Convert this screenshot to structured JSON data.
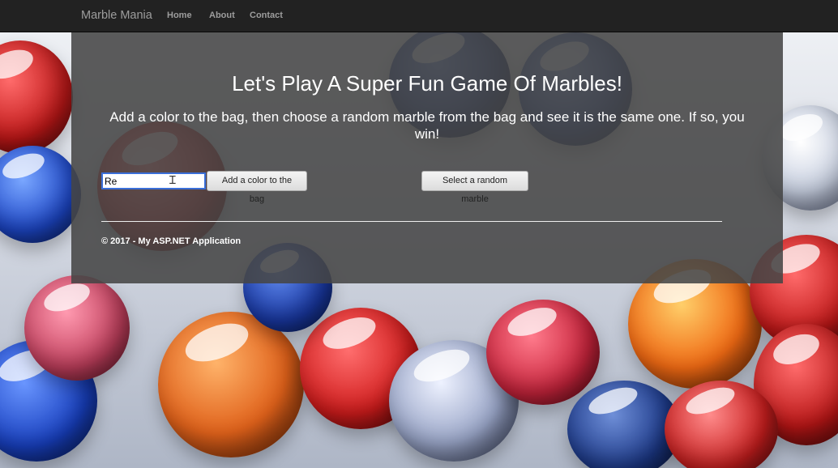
{
  "navbar": {
    "brand": "Marble Mania",
    "links": [
      {
        "label": "Home"
      },
      {
        "label": "About"
      },
      {
        "label": "Contact"
      }
    ]
  },
  "main": {
    "title": "Let's Play A Super Fun Game Of Marbles!",
    "subtitle": "Add a color to the bag, then choose a random marble from the bag and see it is the same one. If so, you win!",
    "color_input": {
      "value": "Re",
      "placeholder": ""
    },
    "add_button_label": "Add a color to the bag",
    "random_button_label": "Select a random marble"
  },
  "footer": {
    "text": "© 2017 - My ASP.NET Application"
  },
  "colors": {
    "navbar_bg": "#222222",
    "nav_text": "#9d9d9d",
    "panel_bg": "#464646",
    "input_border": "#3a6fd8"
  },
  "icons": {
    "text_cursor": "text-cursor-icon"
  }
}
